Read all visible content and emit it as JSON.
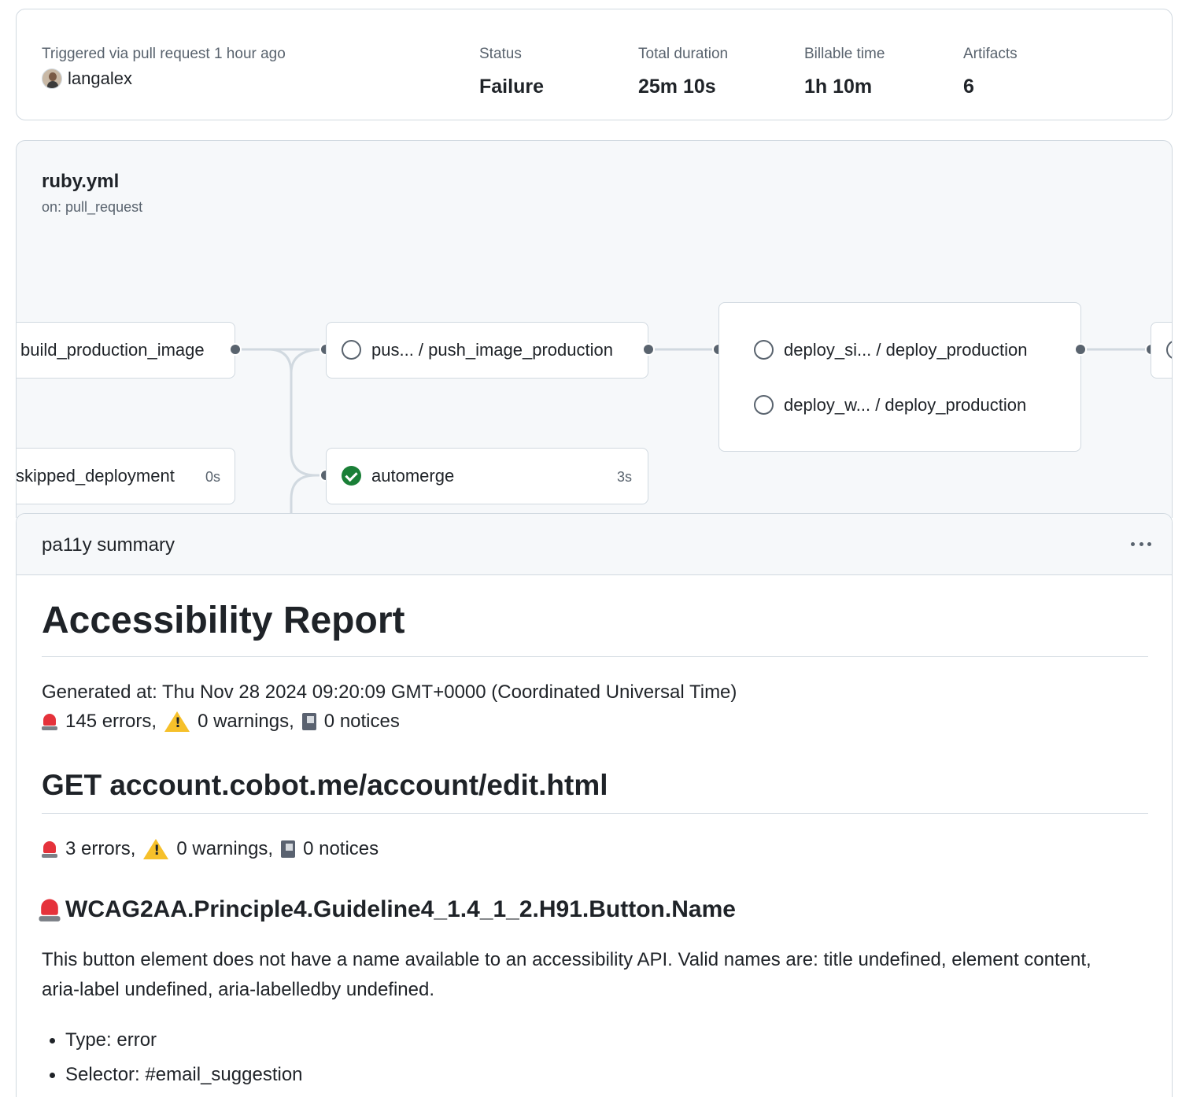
{
  "summary": {
    "trigger_label": "Triggered via pull request 1 hour ago",
    "actor": "langalex",
    "status_label": "Status",
    "status_value": "Failure",
    "duration_label": "Total duration",
    "duration_value": "25m 10s",
    "billable_label": "Billable time",
    "billable_value": "1h 10m",
    "artifacts_label": "Artifacts",
    "artifacts_value": "6"
  },
  "workflow": {
    "file": "ruby.yml",
    "trigger": "on: pull_request",
    "jobs": {
      "build_production_image": "build_production_image",
      "skipped_deployment": "skipped_deployment",
      "skipped_deployment_duration": "0s",
      "push_image": "pus... / push_image_production",
      "automerge": "automerge",
      "automerge_duration": "3s",
      "deploy_1": "deploy_si... / deploy_production",
      "deploy_2": "deploy_w... / deploy_production"
    }
  },
  "panel": {
    "title": "pa11y summary",
    "report_title": "Accessibility Report",
    "generated": "Generated at: Thu Nov 28 2024 09:20:09 GMT+0000 (Coordinated Universal Time)",
    "totals": {
      "errors": "145 errors,",
      "warnings": "0 warnings,",
      "notices": "0 notices"
    },
    "page_heading": "GET account.cobot.me/account/edit.html",
    "page_totals": {
      "errors": "3 errors,",
      "warnings": "0 warnings,",
      "notices": "0 notices"
    },
    "issue_heading": "WCAG2AA.Principle4.Guideline4_1.4_1_2.H91.Button.Name",
    "issue_text": "This button element does not have a name available to an accessibility API. Valid names are: title undefined, element content, aria-label undefined, aria-labelledby undefined.",
    "issue_type": "Type: error",
    "issue_selector": "Selector: #email_suggestion"
  }
}
